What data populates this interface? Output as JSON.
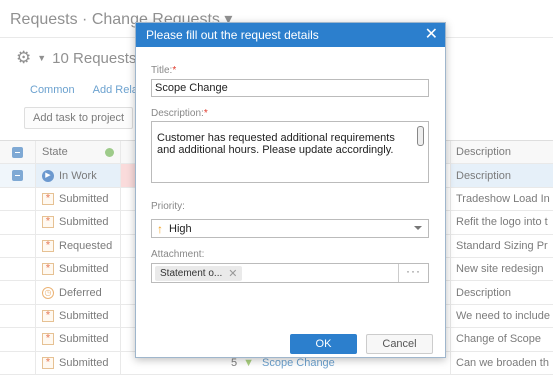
{
  "header": {
    "breadcrumb": "Requests · Change Requests ▾"
  },
  "toolbar": {
    "count_label": "10 Requests"
  },
  "links": {
    "common": "Common",
    "add_related": "Add Relat"
  },
  "buttons": {
    "add_task": "Add task to project"
  },
  "grid": {
    "columns": {
      "state": "State",
      "description": "Description"
    },
    "rows": [
      {
        "state": "In Work",
        "icon": "in-work-icon",
        "description": "Description"
      },
      {
        "state": "Submitted",
        "icon": "submitted-icon",
        "description": "Tradeshow Load In"
      },
      {
        "state": "Submitted",
        "icon": "submitted-icon",
        "description": "Refit the logo into t"
      },
      {
        "state": "Requested",
        "icon": "submitted-icon",
        "description": "Standard Sizing Pr"
      },
      {
        "state": "Submitted",
        "icon": "submitted-icon",
        "description": "New site redesign"
      },
      {
        "state": "Deferred",
        "icon": "deferred-icon",
        "description": "Description"
      },
      {
        "state": "Submitted",
        "icon": "submitted-icon",
        "description": "We need to include"
      },
      {
        "state": "Submitted",
        "icon": "submitted-icon",
        "description": "Change of Scope"
      },
      {
        "state": "Submitted",
        "icon": "submitted-icon",
        "description": "Can we broaden th",
        "mid_number": "5",
        "mid_link": "Scope Change"
      }
    ]
  },
  "modal": {
    "title": "Please fill out the request details",
    "title_label": "Title:",
    "title_value": "Scope Change",
    "description_label": "Description:",
    "description_value": "Customer has requested additional requirements and additional hours. Please update accordingly.",
    "priority_label": "Priority:",
    "priority_value": "High",
    "attachment_label": "Attachment:",
    "attachment_chip": "Statement o...",
    "ok": "OK",
    "cancel": "Cancel"
  },
  "colors": {
    "accent": "#2c7fcd",
    "required": "#e0392b",
    "link": "#1c6fb5"
  }
}
